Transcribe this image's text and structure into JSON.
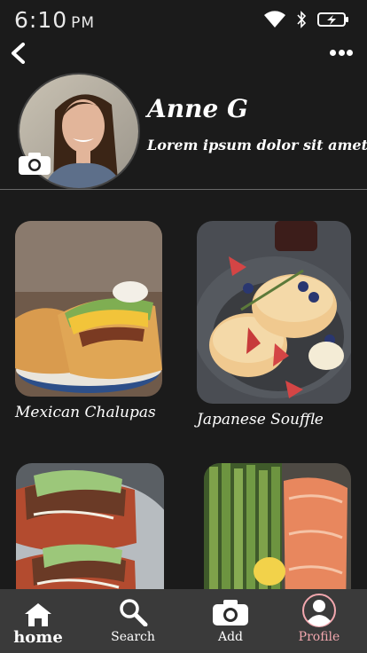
{
  "status": {
    "time": "6:10",
    "ampm": "PM"
  },
  "profile": {
    "name": "Anne G",
    "bio": "Lorem ipsum dolor sit amet,"
  },
  "recipes": [
    {
      "title": "Mexican Chalupas"
    },
    {
      "title": "Japanese Souffle"
    },
    {
      "title": ""
    },
    {
      "title": ""
    }
  ],
  "tabbar": {
    "home": "home",
    "search": "Search",
    "add": "Add",
    "profile": "Profile"
  },
  "colors": {
    "background": "#1b1b1b",
    "tabbar": "#3a3a3a",
    "active_tab": "#f2a7ae"
  }
}
